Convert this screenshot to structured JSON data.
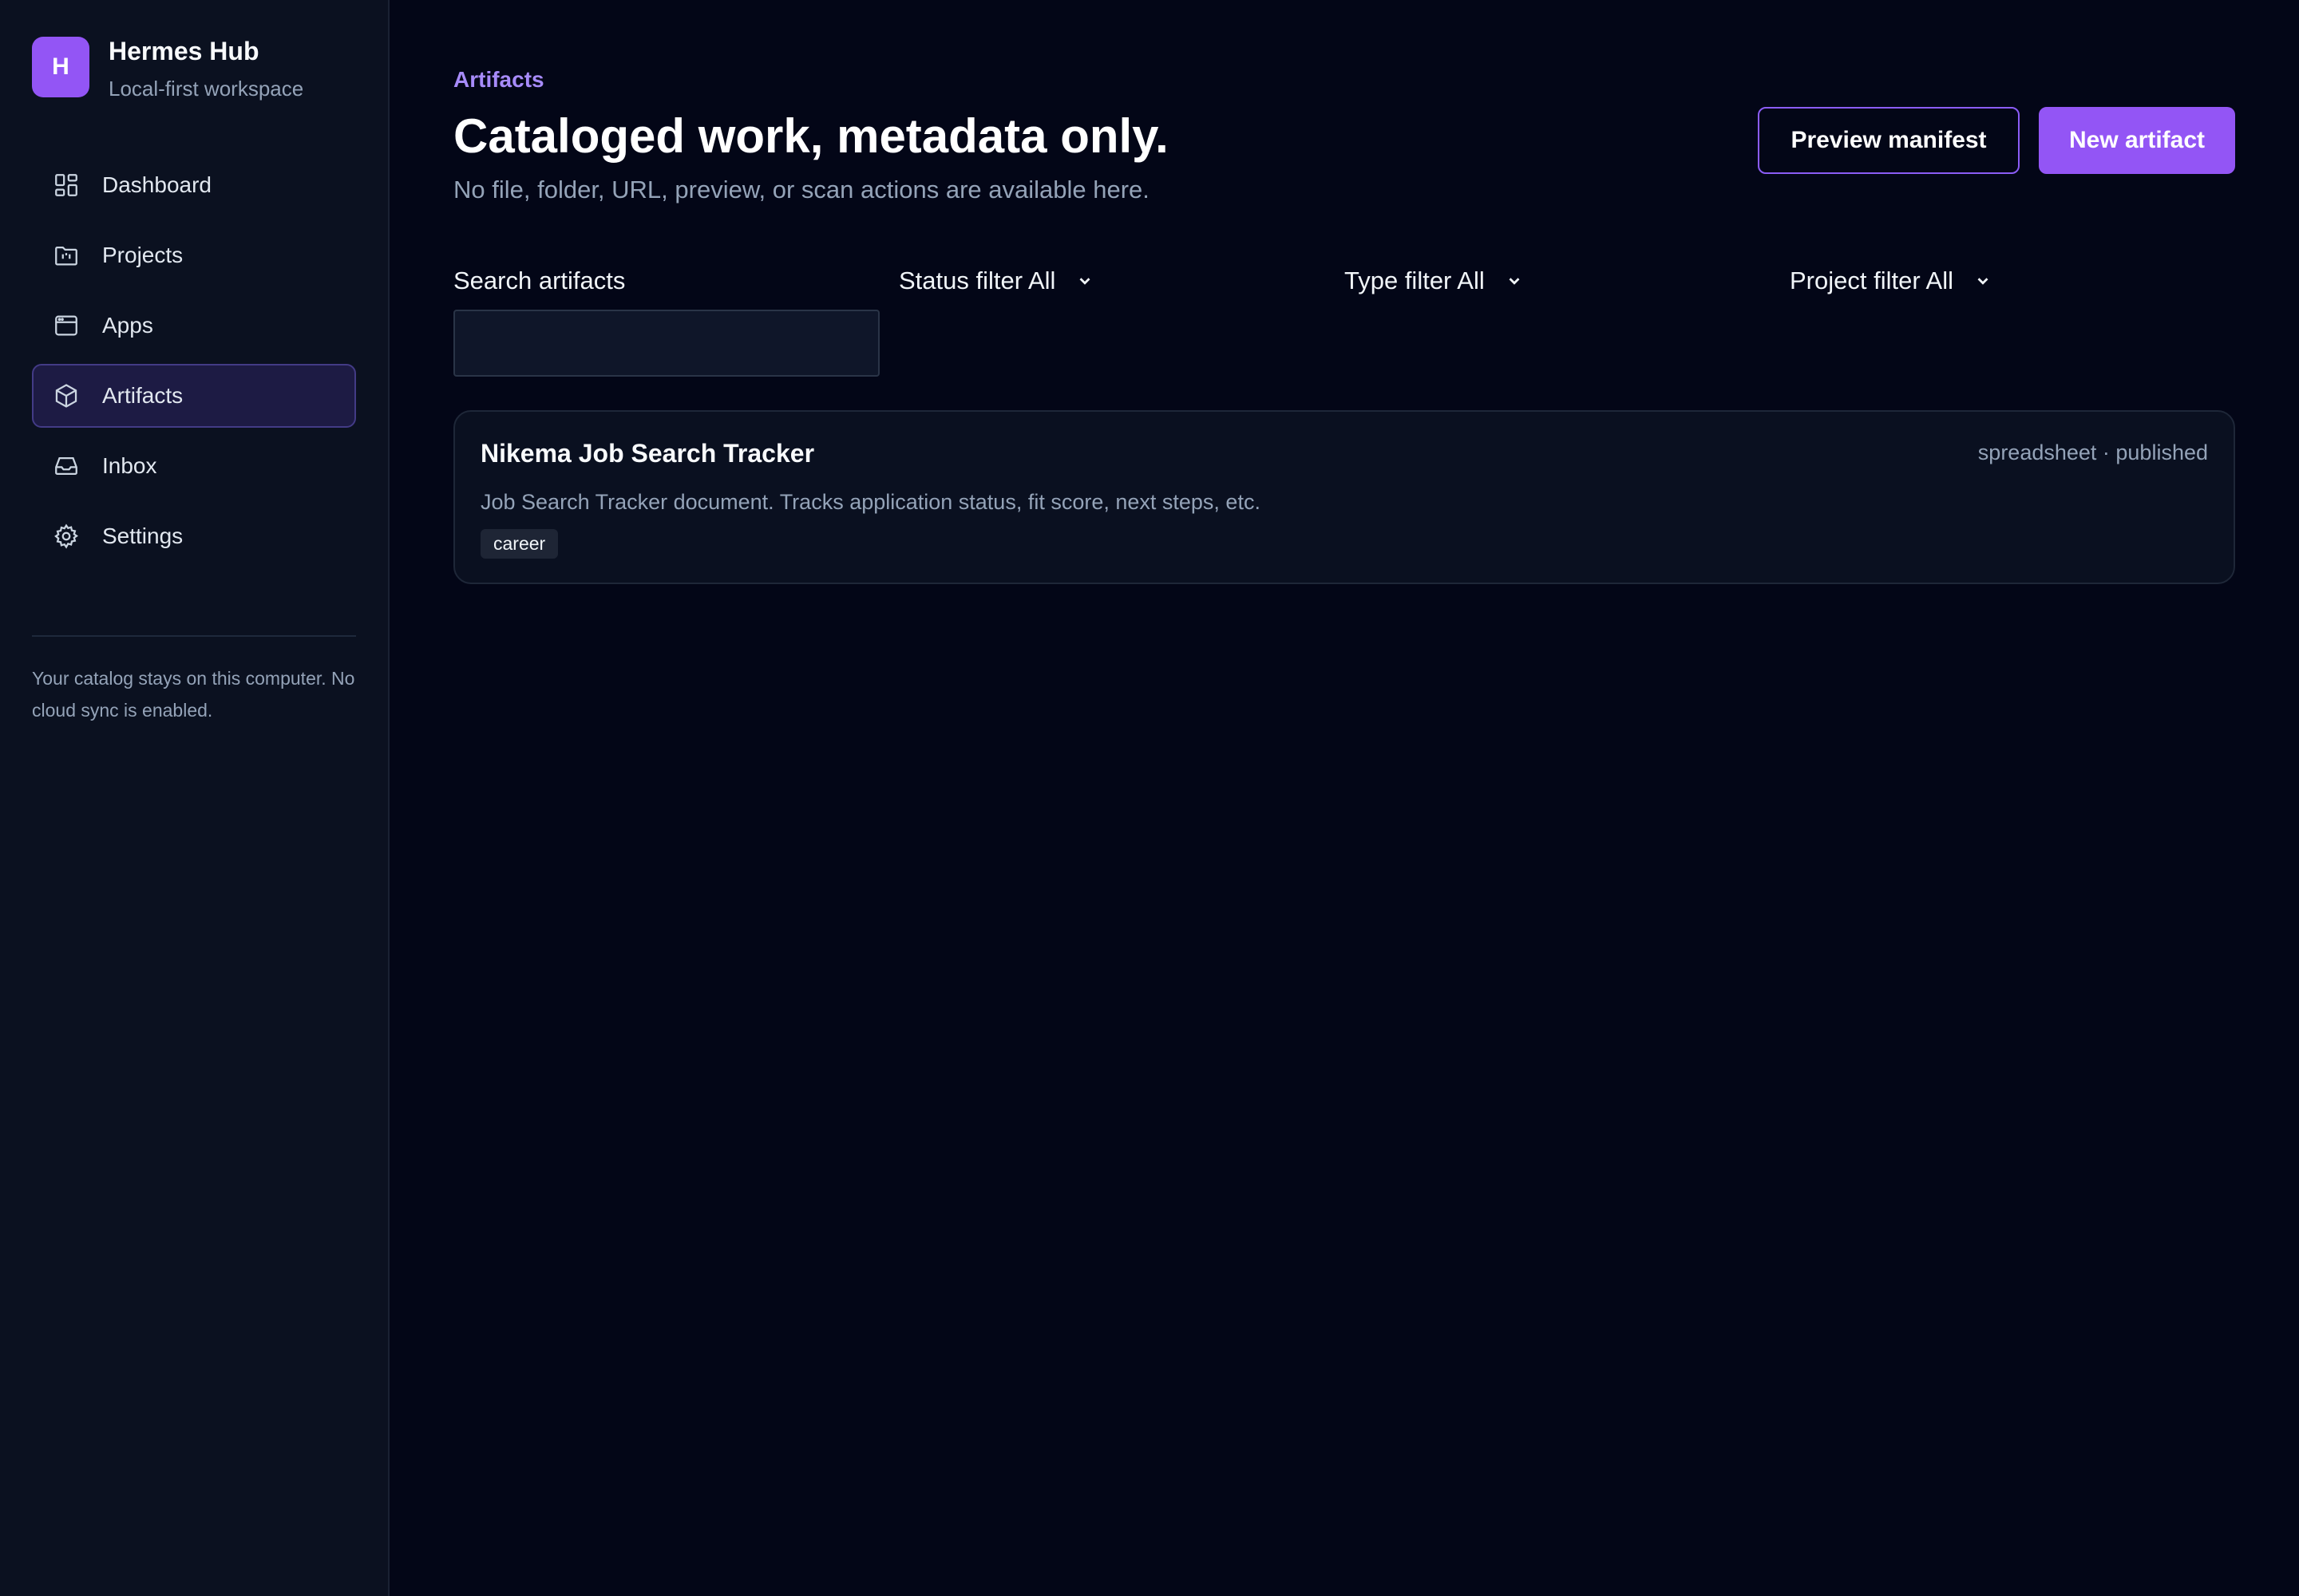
{
  "brand": {
    "logo_letter": "H",
    "name": "Hermes Hub",
    "subtitle": "Local-first workspace"
  },
  "sidebar": {
    "items": [
      {
        "label": "Dashboard",
        "icon": "dashboard-icon",
        "active": false
      },
      {
        "label": "Projects",
        "icon": "folder-icon",
        "active": false
      },
      {
        "label": "Apps",
        "icon": "window-icon",
        "active": false
      },
      {
        "label": "Artifacts",
        "icon": "cube-icon",
        "active": true
      },
      {
        "label": "Inbox",
        "icon": "inbox-icon",
        "active": false
      },
      {
        "label": "Settings",
        "icon": "gear-icon",
        "active": false
      }
    ],
    "note": "Your catalog stays on this computer. No cloud sync is enabled."
  },
  "header": {
    "eyebrow": "Artifacts",
    "title": "Cataloged work, metadata only.",
    "subtitle": "No file, folder, URL, preview, or scan actions are available here.",
    "preview_button": "Preview manifest",
    "new_button": "New artifact"
  },
  "filters": {
    "search_label": "Search artifacts",
    "search_value": "",
    "status": "Status filter All",
    "type": "Type filter All",
    "project": "Project filter All"
  },
  "artifacts": [
    {
      "title": "Nikema Job Search Tracker",
      "meta": "spreadsheet · published",
      "description": "Job Search Tracker document. Tracks application status, fit score, next steps, etc.",
      "tag": "career"
    }
  ],
  "colors": {
    "accent": "#9355f5",
    "accent_light": "#a78bfa",
    "background": "#030617",
    "sidebar": "#0b1120"
  }
}
